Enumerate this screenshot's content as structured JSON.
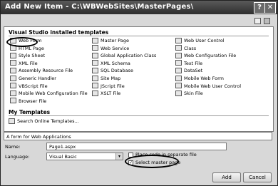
{
  "window": {
    "title": "Add New Item - C:\\WBWebSites\\MasterPages\\",
    "help_glyph": "?",
    "close_glyph": "✕"
  },
  "templates": {
    "section_installed": "Visual Studio installed templates",
    "col1": [
      "Web Form",
      "HTML Page",
      "Style Sheet",
      "XML File",
      "Assembly Resource File",
      "Generic Handler",
      "VBScript File",
      "Mobile Web Configuration File",
      "Browser File"
    ],
    "col2": [
      "Master Page",
      "Web Service",
      "Global Application Class",
      "XML Schema",
      "SQL Database",
      "Site Map",
      "JScript File",
      "XSLT File"
    ],
    "col3": [
      "Web User Control",
      "Class",
      "Web Configuration File",
      "Text File",
      "DataSet",
      "Mobile Web Form",
      "Mobile Web User Control",
      "Skin File"
    ],
    "section_my": "My Templates",
    "my_items": [
      "Search Online Templates..."
    ]
  },
  "description": "A form for Web Applications",
  "form": {
    "name_label": "Name:",
    "name_value": "Page1.aspx",
    "language_label": "Language:",
    "language_value": "Visual Basic",
    "chk_separate_label": "Place code in separate file",
    "chk_master_label": "Select master page"
  },
  "buttons": {
    "add": "Add",
    "cancel": "Cancel"
  },
  "icons": {
    "grid_view": "large-icons-view-icon",
    "list_view": "small-icons-view-icon"
  }
}
